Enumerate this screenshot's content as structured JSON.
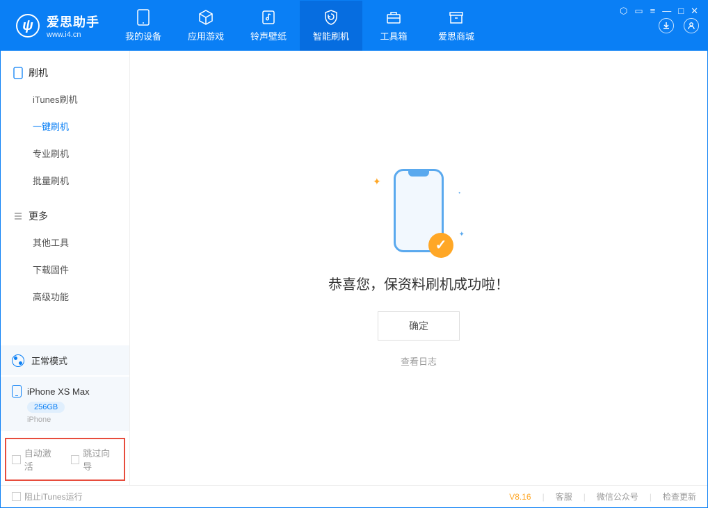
{
  "app": {
    "title": "爱思助手",
    "subtitle": "www.i4.cn"
  },
  "tabs": [
    {
      "label": "我的设备"
    },
    {
      "label": "应用游戏"
    },
    {
      "label": "铃声壁纸"
    },
    {
      "label": "智能刷机"
    },
    {
      "label": "工具箱"
    },
    {
      "label": "爱思商城"
    }
  ],
  "sidebar": {
    "section1": {
      "title": "刷机",
      "items": [
        "iTunes刷机",
        "一键刷机",
        "专业刷机",
        "批量刷机"
      ]
    },
    "section2": {
      "title": "更多",
      "items": [
        "其他工具",
        "下载固件",
        "高级功能"
      ]
    }
  },
  "mode": "正常模式",
  "device": {
    "name": "iPhone XS Max",
    "storage": "256GB",
    "type": "iPhone"
  },
  "checks": {
    "auto_activate": "自动激活",
    "skip_guide": "跳过向导"
  },
  "main": {
    "success": "恭喜您，保资料刷机成功啦！",
    "ok": "确定",
    "log": "查看日志"
  },
  "status": {
    "stop_itunes": "阻止iTunes运行",
    "version": "V8.16",
    "support": "客服",
    "wechat": "微信公众号",
    "update": "检查更新"
  }
}
